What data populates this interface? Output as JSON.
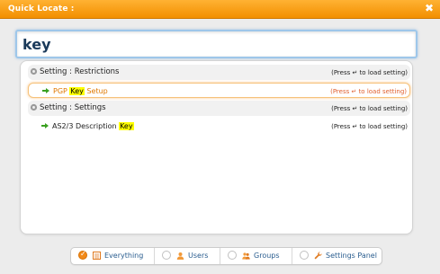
{
  "window": {
    "title": "Quick Locate :",
    "close_glyph": "✖"
  },
  "search": {
    "value": "key"
  },
  "results": [
    {
      "group_label": "Setting : Restrictions",
      "group_hint": "(Press ↵ to load setting)",
      "item_prefix": "PGP ",
      "item_match": "Key",
      "item_suffix": " Setup",
      "item_hint": "(Press ↵ to load setting)"
    },
    {
      "group_label": "Setting : Settings",
      "group_hint": "(Press ↵ to load setting)",
      "item_prefix": "AS2/3 Description ",
      "item_match": "Key",
      "item_suffix": "",
      "item_hint": "(Press ↵ to load setting)"
    }
  ],
  "filters": [
    {
      "label": "Everything",
      "selected": true,
      "icon": "list-icon"
    },
    {
      "label": "Users",
      "selected": false,
      "icon": "user-icon"
    },
    {
      "label": "Groups",
      "selected": false,
      "icon": "group-icon"
    },
    {
      "label": "Settings Panel",
      "selected": false,
      "icon": "wrench-icon"
    }
  ],
  "colors": {
    "accent": "#f28f00",
    "highlight": "#ffff00",
    "link": "#2a5d8f"
  }
}
